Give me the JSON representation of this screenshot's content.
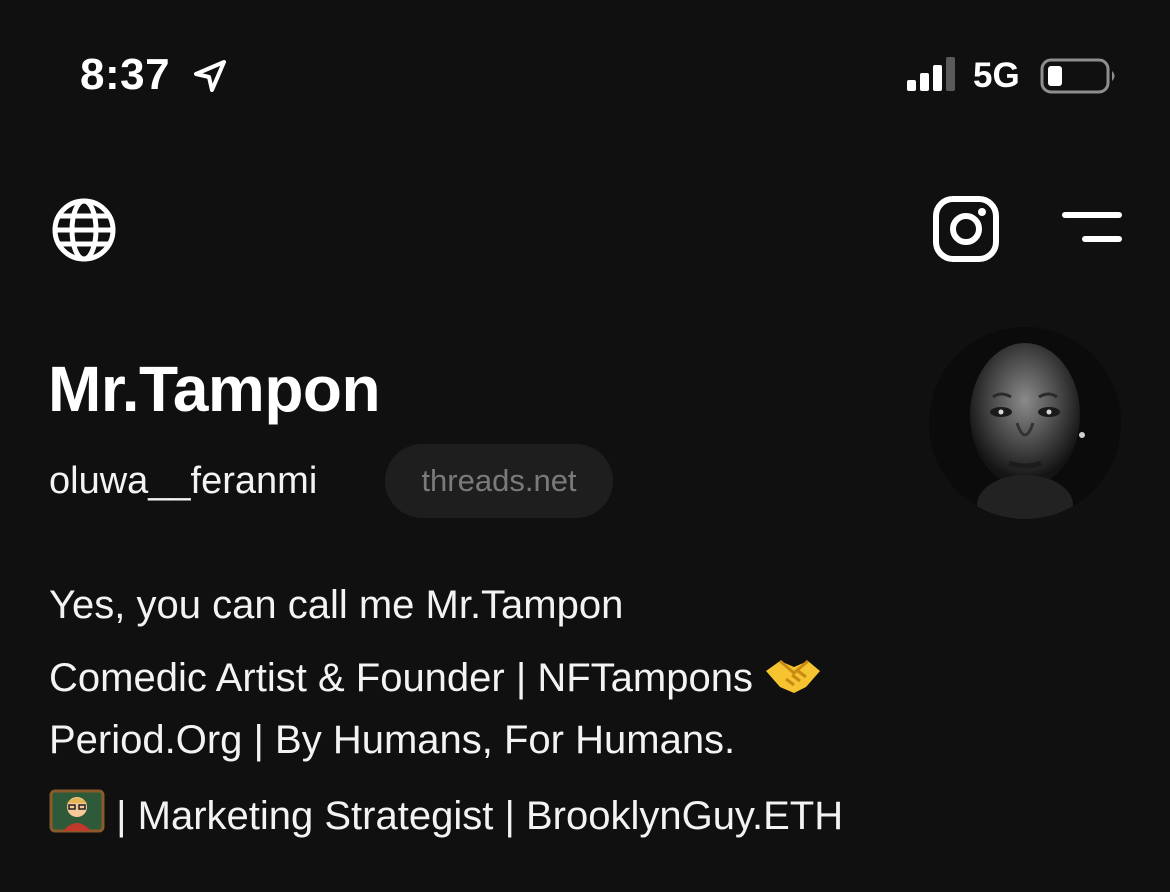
{
  "status_bar": {
    "time": "8:37",
    "network": "5G",
    "icons": [
      "location-arrow-icon",
      "signal-bars-icon",
      "battery-icon"
    ]
  },
  "nav": {
    "icons": [
      "globe-icon",
      "instagram-icon",
      "menu-icon"
    ]
  },
  "profile": {
    "display_name": "Mr.Tampon",
    "username": "oluwa__feranmi",
    "domain": "threads.net",
    "avatar": "avatar-photo"
  },
  "bio": {
    "line1": "Yes, you can call me Mr.Tampon",
    "line2": "Comedic Artist & Founder | NFTampons",
    "line2_emoji": "handshake-emoji",
    "line3": "Period.Org | By Humans, For Humans.",
    "line4_emoji": "teacher-emoji",
    "line4": " | Marketing Strategist | BrooklynGuy.ETH"
  },
  "colors": {
    "background": "#101010",
    "text": "#f3f3f3",
    "muted": "#7a7a7a",
    "pill": "#1e1e1e"
  }
}
